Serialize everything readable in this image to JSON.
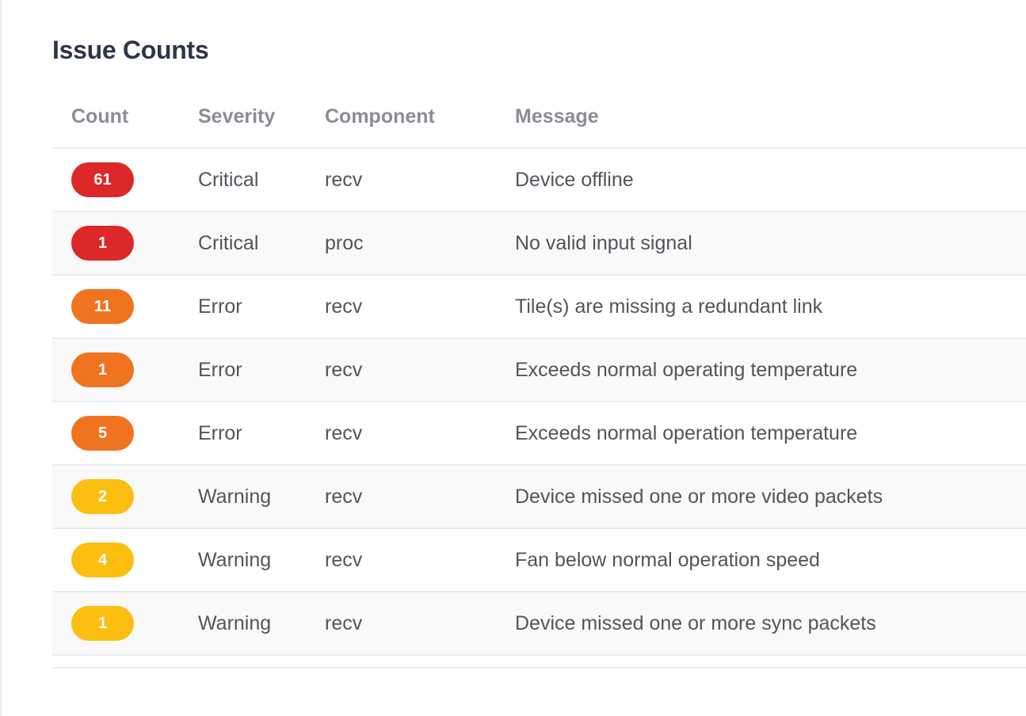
{
  "panel": {
    "title": "Issue Counts"
  },
  "table": {
    "columns": [
      "Count",
      "Severity",
      "Component",
      "Message"
    ],
    "rows": [
      {
        "count": "61",
        "severity": "Critical",
        "component": "recv",
        "message": "Device offline"
      },
      {
        "count": "1",
        "severity": "Critical",
        "component": "proc",
        "message": "No valid input signal"
      },
      {
        "count": "11",
        "severity": "Error",
        "component": "recv",
        "message": "Tile(s) are missing a redundant link"
      },
      {
        "count": "1",
        "severity": "Error",
        "component": "recv",
        "message": "Exceeds normal operating temperature"
      },
      {
        "count": "5",
        "severity": "Error",
        "component": "recv",
        "message": "Exceeds normal operation temperature"
      },
      {
        "count": "2",
        "severity": "Warning",
        "component": "recv",
        "message": "Device missed one or more video packets"
      },
      {
        "count": "4",
        "severity": "Warning",
        "component": "recv",
        "message": "Fan below normal operation speed"
      },
      {
        "count": "1",
        "severity": "Warning",
        "component": "recv",
        "message": "Device missed one or more sync packets"
      }
    ]
  },
  "severity_colors": {
    "Critical": "#dc2828",
    "Error": "#f07320",
    "Warning": "#fcbe10"
  }
}
